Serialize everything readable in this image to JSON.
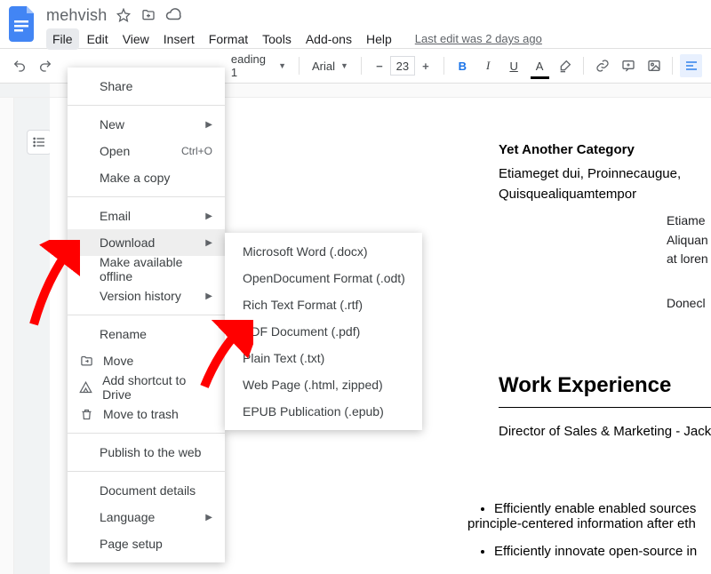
{
  "doc": {
    "title": "mehvish",
    "last_edit": "Last edit was 2 days ago"
  },
  "menubar": {
    "items": [
      "File",
      "Edit",
      "View",
      "Insert",
      "Format",
      "Tools",
      "Add-ons",
      "Help"
    ]
  },
  "toolbar": {
    "style": "eading 1",
    "font": "Arial",
    "font_size": "23"
  },
  "file_menu": {
    "share": "Share",
    "new": "New",
    "open": "Open",
    "open_shortcut": "Ctrl+O",
    "make_copy": "Make a copy",
    "email": "Email",
    "download": "Download",
    "make_offline": "Make available offline",
    "version_history": "Version history",
    "rename": "Rename",
    "move": "Move",
    "add_shortcut": "Add shortcut to Drive",
    "trash": "Move to trash",
    "publish": "Publish to the web",
    "doc_details": "Document details",
    "language": "Language",
    "page_setup": "Page setup"
  },
  "download_menu": {
    "docx": "Microsoft Word (.docx)",
    "odt": "OpenDocument Format (.odt)",
    "rtf": "Rich Text Format (.rtf)",
    "pdf": "PDF Document (.pdf)",
    "txt": "Plain Text (.txt)",
    "html": "Web Page (.html, zipped)",
    "epub": "EPUB Publication (.epub)"
  },
  "doc_body": {
    "cat_heading": "Yet Another Category",
    "cat_text": "Etiameget dui, Proinnecaugue, Quisquealiquamtempor",
    "work_h": "Work Experience",
    "work_line": "Director of Sales & Marketing - Jackso",
    "bullet1": "Efficiently enable enabled sources",
    "bullet1b": "principle-centered information after eth",
    "bullet2": "Efficiently innovate open-source in",
    "snip1": "Etiame",
    "snip2": "Aliquan",
    "snip3": "at loren",
    "snip4": "Donecl"
  }
}
